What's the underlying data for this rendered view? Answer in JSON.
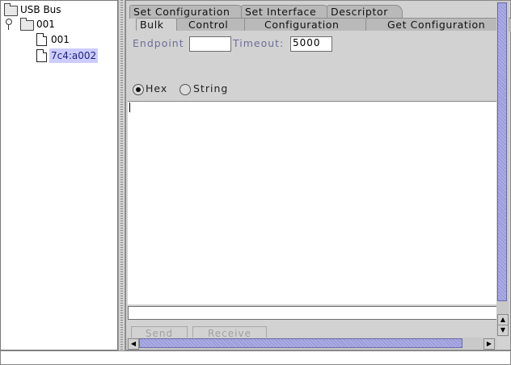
{
  "tree": {
    "root": {
      "label": "USB Bus",
      "icon": "folder-icon"
    },
    "bus": {
      "label": "001",
      "icon": "folder-icon"
    },
    "devices": [
      {
        "label": "001",
        "icon": "file-icon",
        "selected": false
      },
      {
        "label": "7c4:a002",
        "icon": "file-icon",
        "selected": true
      }
    ]
  },
  "tabs": {
    "row1": [
      "Set Configuration",
      "Set Interface",
      "Descriptor"
    ],
    "row2": [
      "Bulk",
      "Control",
      "Configuration",
      "Get Configuration"
    ],
    "active": "Bulk"
  },
  "bulk": {
    "endpoint_label": "Endpoint",
    "endpoint_value": "",
    "timeout_label": "Timeout:",
    "timeout_value": "5000",
    "mode_hex": "Hex",
    "mode_string": "String",
    "selected_mode": "Hex",
    "data_text": "",
    "input_value": "",
    "send_label": "Send",
    "receive_label": "Receive"
  },
  "colors": {
    "panel_bg": "#d2d2d2",
    "selection_bg": "#ccccff",
    "label_color": "#6e6e9a",
    "scroll_thumb": "#9c9cd8"
  }
}
